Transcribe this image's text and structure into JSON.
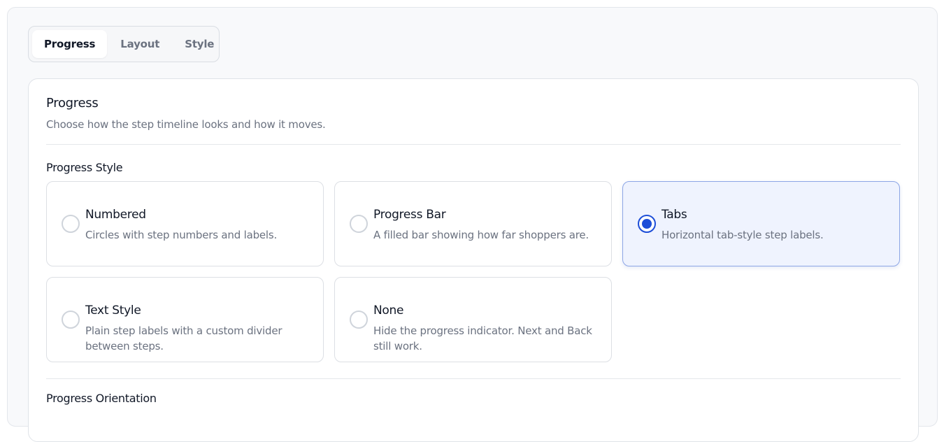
{
  "tabs": [
    {
      "label": "Progress",
      "active": true
    },
    {
      "label": "Layout",
      "active": false
    },
    {
      "label": "Style",
      "active": false
    }
  ],
  "panel": {
    "title": "Progress",
    "description": "Choose how the step timeline looks and how it moves."
  },
  "progress_style": {
    "label": "Progress Style",
    "selected": "Tabs",
    "options": [
      {
        "title": "Numbered",
        "description": "Circles with step numbers and labels.",
        "selected": false
      },
      {
        "title": "Progress Bar",
        "description": "A filled bar showing how far shoppers are.",
        "selected": false
      },
      {
        "title": "Tabs",
        "description": "Horizontal tab-style step labels.",
        "selected": true
      },
      {
        "title": "Text Style",
        "description": "Plain step labels with a custom divider between steps.",
        "selected": false
      },
      {
        "title": "None",
        "description": "Hide the progress indicator. Next and Back still work.",
        "selected": false
      }
    ]
  },
  "progress_orientation": {
    "label": "Progress Orientation"
  },
  "colors": {
    "accent": "#1d4ed8",
    "selected_bg": "#eff3fe",
    "selected_border": "#8da6e6"
  }
}
